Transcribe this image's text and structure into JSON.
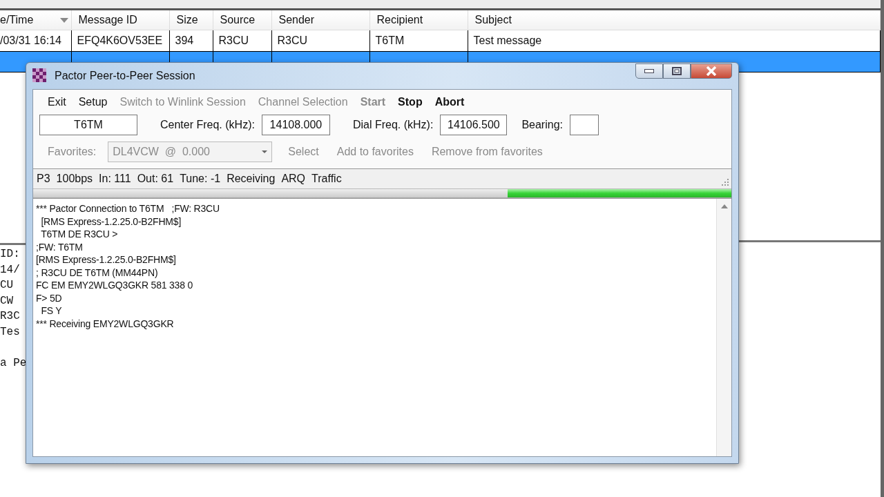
{
  "main_window": {
    "table": {
      "columns": [
        {
          "label": "e/Time",
          "sorted": true
        },
        {
          "label": "Message ID",
          "sorted": false
        },
        {
          "label": "Size",
          "sorted": false
        },
        {
          "label": "Source",
          "sorted": false
        },
        {
          "label": "Sender",
          "sorted": false
        },
        {
          "label": "Recipient",
          "sorted": false
        },
        {
          "label": "Subject",
          "sorted": false
        }
      ],
      "rows": [
        {
          "selected": false,
          "cells": [
            "/03/31 16:14",
            "EFQ4K6OV53EE",
            "394",
            "R3CU",
            "R3CU",
            "T6TM",
            "Test message"
          ]
        },
        {
          "selected": true
        }
      ]
    },
    "details_lines": [
      "ID:",
      "14/",
      "CU",
      "CW",
      "R3C",
      "Tes",
      "a Pe"
    ]
  },
  "dialog": {
    "title": "Pactor Peer-to-Peer Session",
    "menu": [
      {
        "label": "Exit",
        "bold": false,
        "disabled": false
      },
      {
        "label": "Setup",
        "bold": false,
        "disabled": false
      },
      {
        "label": "Switch to Winlink Session",
        "bold": false,
        "disabled": true
      },
      {
        "label": "Channel Selection",
        "bold": false,
        "disabled": true
      },
      {
        "label": "Start",
        "bold": true,
        "disabled": true
      },
      {
        "label": "Stop",
        "bold": true,
        "disabled": false
      },
      {
        "label": "Abort",
        "bold": true,
        "disabled": false
      }
    ],
    "callsign": "T6TM",
    "center_freq": {
      "label": "Center Freq. (kHz):",
      "value": "14108.000"
    },
    "dial_freq": {
      "label": "Dial Freq. (kHz):",
      "value": "14106.500"
    },
    "bearing": {
      "label": "Bearing:"
    },
    "favorites": {
      "disabled": true,
      "label": "Favorites:",
      "value": "DL4VCW  @  0.000",
      "actions": [
        "Select",
        "Add to favorites",
        "Remove from favorites"
      ]
    },
    "status": [
      "P3",
      "100bps",
      "In: 111",
      "Out: 61",
      "Tune: -1",
      "Receiving",
      "ARQ",
      "Traffic"
    ],
    "progress": {
      "level": 0.32
    },
    "log": [
      "*** Pactor Connection to T6TM   ;FW: R3CU",
      "  [RMS Express-1.2.25.0-B2FHM$]",
      "  T6TM DE R3CU >",
      ";FW: T6TM",
      "[RMS Express-1.2.25.0-B2FHM$]",
      "; R3CU DE T6TM (MM44PN)",
      "FC EM EMY2WLGQ3GKR 581 338 0",
      "F> 5D",
      "  FS Y",
      "*** Receiving EMY2WLGQ3GKR"
    ]
  }
}
